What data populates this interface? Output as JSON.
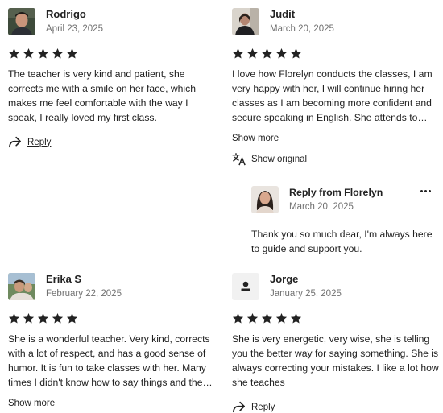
{
  "reviews": [
    {
      "name": "Rodrigo",
      "date": "April 23, 2025",
      "rating": 5,
      "text": "The teacher is very kind and patient, she corrects me with a smile on her face, which makes me feel comfortable with the way I speak, I really loved my first class.",
      "action_label": "Reply",
      "avatar_icon": "user-photo"
    },
    {
      "name": "Judit",
      "date": "March 20, 2025",
      "rating": 5,
      "text": "I love how Florelyn conducts the classes, I am very happy with her, I will continue hiring her classes as I am becoming more confident and secure speaking in English. She attends to…",
      "action_label": "Show more",
      "translate_label": "Show original",
      "avatar_icon": "user-photo"
    },
    {
      "name": "Erika S",
      "date": "February 22, 2025",
      "rating": 5,
      "text": "She is a wonderful teacher. Very kind, corrects with a lot of respect, and has a good sense of humor. It is fun to take classes with her. Many times I didn't know how to say things and the…",
      "action_label": "Show more",
      "avatar_icon": "user-photo"
    },
    {
      "name": "Jorge",
      "date": "January 25, 2025",
      "rating": 5,
      "text": "She is very energetic, very wise, she is telling you the better way for saying something. She is always correcting your mistakes. I like a lot how she teaches",
      "action_label": "Reply",
      "avatar_icon": "default-user-icon"
    }
  ],
  "host_reply": {
    "title": "Reply from Florelyn",
    "date": "March 20, 2025",
    "text": "Thank you so much dear, I'm always here to guide and support you."
  },
  "colors": {
    "text": "#222222",
    "muted": "#717171",
    "star": "#222222"
  }
}
